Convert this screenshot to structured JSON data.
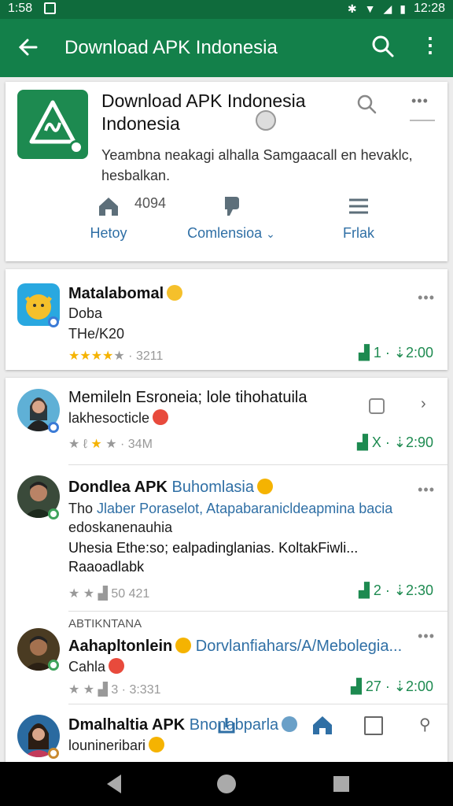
{
  "status_bar": {
    "time": "1:58",
    "clock": "12:28"
  },
  "app_bar": {
    "title": "Download APK Indonesia"
  },
  "header": {
    "title": "Download APK Indonesia Indonesia",
    "description": "Yeambna neakagi alhalla Samgaacall en hevaklc, hesbalkan.",
    "count": "4094",
    "actions": [
      {
        "label": "Hetoy",
        "icon": "home-icon"
      },
      {
        "label": "Comlensioa",
        "icon": "thumb-icon"
      },
      {
        "label": "Frlak",
        "icon": "menu-icon"
      }
    ]
  },
  "items": [
    {
      "name": "Matalabomal",
      "line2": "Doba",
      "line3": "THe/K20",
      "rating_count": "3211",
      "stats_a": "1",
      "stats_b": "2:00"
    },
    {
      "name": "Memileln Esroneia; lole tihohatuila",
      "line2": "lakhesocticle",
      "rating_count": "34M",
      "stats_a": "X",
      "stats_b": "2:90"
    },
    {
      "name": "Dondlea APK",
      "name_blue": "Buhomlasia",
      "line2_a": "Tho",
      "line2_b": "Jlaber Poraselot, Atapabaranicldeapmina bacia",
      "line3": "edoskanenauhia",
      "line4": "Uhesia Ethe:so; ealpadinglanias. KoltakFiwli...",
      "line5": "Raaoadlabk",
      "rating_count": "50 421",
      "stats_a": "2",
      "stats_b": "2:30"
    },
    {
      "overline": "ABTIKNTANA",
      "name": "Aahapltonlein",
      "name_blue": "Dorvlanfiahars/A/Mebolegia...",
      "line2": "Cahla",
      "rating_a": "3",
      "rating_count": "3:331",
      "stats_a": "27",
      "stats_b": "2:00"
    },
    {
      "name": "Dmalhaltia APK",
      "name_blue": "Bnonabparla",
      "line2": "lounineribari"
    }
  ]
}
